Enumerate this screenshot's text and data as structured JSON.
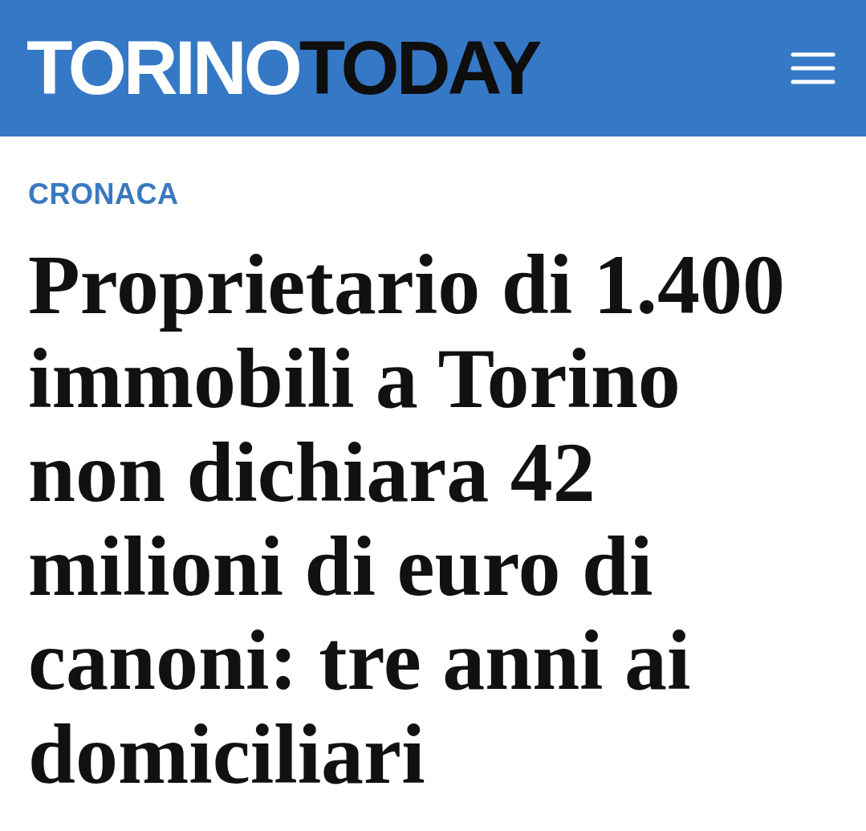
{
  "header": {
    "logo": [
      {
        "text": "TORINO",
        "color": "#ffffff"
      },
      {
        "text": "TODAY",
        "color": "#0e0e0e"
      }
    ]
  },
  "article": {
    "category": "CRONACA",
    "headline": "Proprietario di 1.400 immobili a Torino non dichiara 42 milioni di euro di canoni: tre anni ai domiciliari"
  }
}
